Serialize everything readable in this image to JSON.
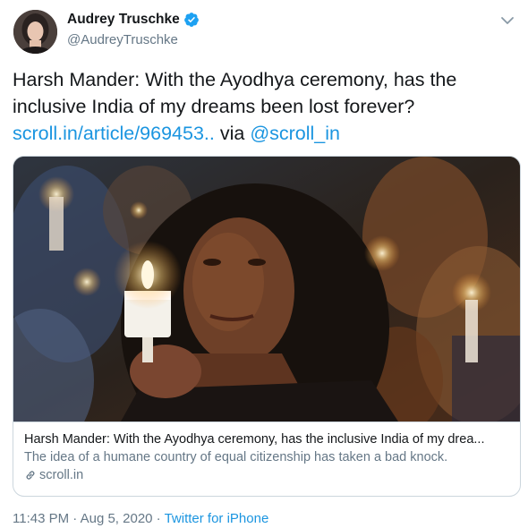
{
  "author": {
    "display_name": "Audrey Truschke",
    "handle": "@AudreyTruschke",
    "verified": true
  },
  "tweet": {
    "text": "Harsh Mander: With the Ayodhya ceremony, has the inclusive India of my dreams been lost forever?",
    "link_text": "scroll.in/article/969453..",
    "via_text": " via ",
    "mention": "@scroll_in"
  },
  "card": {
    "title": "Harsh Mander: With the Ayodhya ceremony, has the inclusive India of my drea...",
    "description": "The idea of a humane country of equal citizenship has taken a bad knock.",
    "domain": "scroll.in"
  },
  "meta": {
    "time": "11:43 PM",
    "separator": " · ",
    "date": "Aug 5, 2020",
    "source": "Twitter for iPhone"
  },
  "icons": {
    "verified": "verified-badge-icon",
    "menu": "chevron-down-icon",
    "link": "link-icon"
  },
  "colors": {
    "link": "#1b95e0",
    "muted": "#657786",
    "border": "#ccd6dd"
  }
}
